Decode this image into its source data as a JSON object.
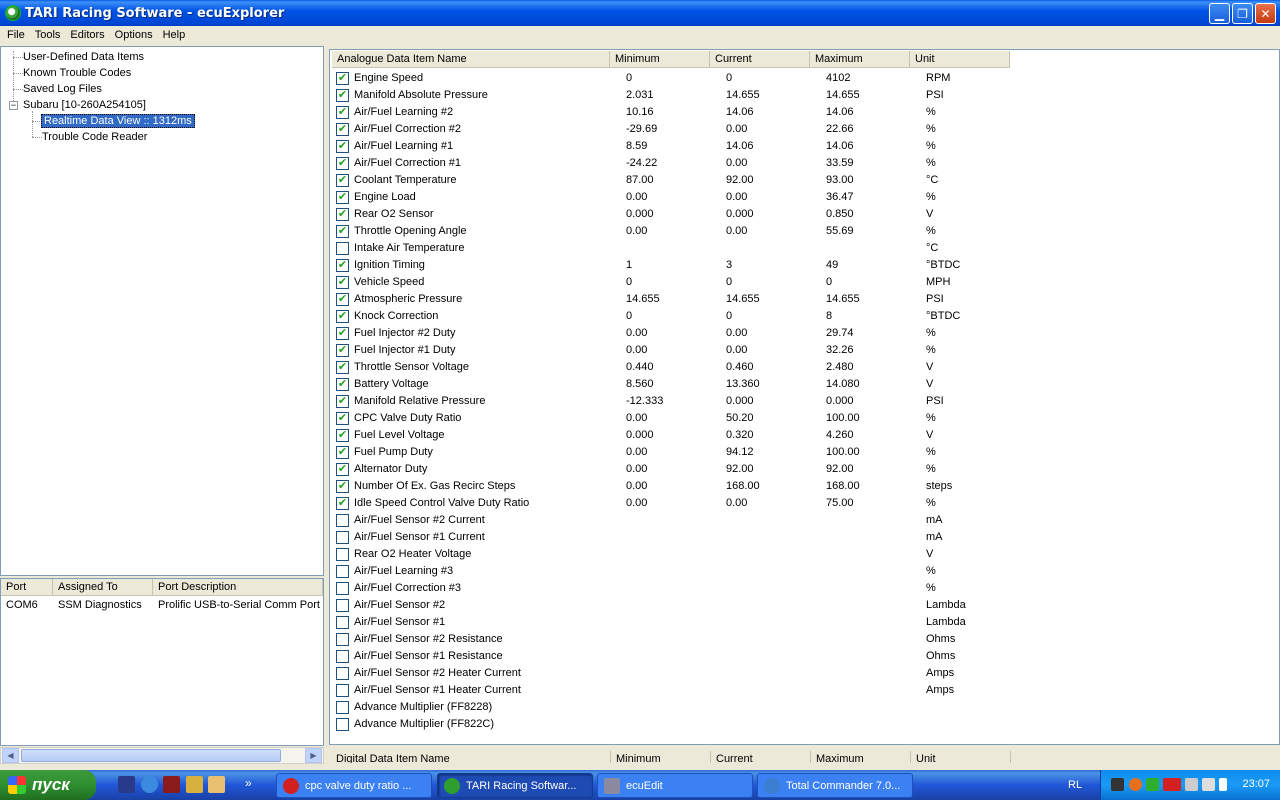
{
  "window": {
    "title": "TARI Racing Software - ecuExplorer"
  },
  "menu": [
    "File",
    "Tools",
    "Editors",
    "Options",
    "Help"
  ],
  "tree": {
    "user_defined": "User-Defined Data Items",
    "known_codes": "Known Trouble Codes",
    "saved_logs": "Saved Log Files",
    "subaru": "Subaru [10-260A254105]",
    "realtime": "Realtime Data View :: 1312ms",
    "trouble_reader": "Trouble Code Reader",
    "expander_symbol": "−"
  },
  "ports": {
    "headers": [
      "Port",
      "Assigned To",
      "Port Description"
    ],
    "rows": [
      [
        "COM6",
        "SSM Diagnostics",
        "Prolific USB-to-Serial Comm Port"
      ]
    ]
  },
  "analogue": {
    "headers": [
      "Analogue Data Item Name",
      "Minimum",
      "Current",
      "Maximum",
      "Unit"
    ],
    "rows": [
      {
        "checked": true,
        "name": "Engine Speed",
        "min": "0",
        "cur": "0",
        "max": "4102",
        "unit": "RPM"
      },
      {
        "checked": true,
        "name": "Manifold Absolute Pressure",
        "min": "2.031",
        "cur": "14.655",
        "max": "14.655",
        "unit": "PSI"
      },
      {
        "checked": true,
        "name": "Air/Fuel Learning #2",
        "min": "10.16",
        "cur": "14.06",
        "max": "14.06",
        "unit": "%"
      },
      {
        "checked": true,
        "name": "Air/Fuel Correction #2",
        "min": "-29.69",
        "cur": "0.00",
        "max": "22.66",
        "unit": "%"
      },
      {
        "checked": true,
        "name": "Air/Fuel Learning #1",
        "min": "8.59",
        "cur": "14.06",
        "max": "14.06",
        "unit": "%"
      },
      {
        "checked": true,
        "name": "Air/Fuel Correction #1",
        "min": "-24.22",
        "cur": "0.00",
        "max": "33.59",
        "unit": "%"
      },
      {
        "checked": true,
        "name": "Coolant Temperature",
        "min": "87.00",
        "cur": "92.00",
        "max": "93.00",
        "unit": "°C"
      },
      {
        "checked": true,
        "name": "Engine Load",
        "min": "0.00",
        "cur": "0.00",
        "max": "36.47",
        "unit": "%"
      },
      {
        "checked": true,
        "name": "Rear O2 Sensor",
        "min": "0.000",
        "cur": "0.000",
        "max": "0.850",
        "unit": "V"
      },
      {
        "checked": true,
        "name": "Throttle Opening Angle",
        "min": "0.00",
        "cur": "0.00",
        "max": "55.69",
        "unit": "%"
      },
      {
        "checked": false,
        "name": "Intake Air Temperature",
        "min": "",
        "cur": "",
        "max": "",
        "unit": "°C"
      },
      {
        "checked": true,
        "name": "Ignition Timing",
        "min": "1",
        "cur": "3",
        "max": "49",
        "unit": "°BTDC"
      },
      {
        "checked": true,
        "name": "Vehicle Speed",
        "min": "0",
        "cur": "0",
        "max": "0",
        "unit": "MPH"
      },
      {
        "checked": true,
        "name": "Atmospheric Pressure",
        "min": "14.655",
        "cur": "14.655",
        "max": "14.655",
        "unit": "PSI"
      },
      {
        "checked": true,
        "name": "Knock Correction",
        "min": "0",
        "cur": "0",
        "max": "8",
        "unit": "°BTDC"
      },
      {
        "checked": true,
        "name": "Fuel Injector #2 Duty",
        "min": "0.00",
        "cur": "0.00",
        "max": "29.74",
        "unit": "%"
      },
      {
        "checked": true,
        "name": "Fuel Injector #1 Duty",
        "min": "0.00",
        "cur": "0.00",
        "max": "32.26",
        "unit": "%"
      },
      {
        "checked": true,
        "name": "Throttle Sensor Voltage",
        "min": "0.440",
        "cur": "0.460",
        "max": "2.480",
        "unit": "V"
      },
      {
        "checked": true,
        "name": "Battery Voltage",
        "min": "8.560",
        "cur": "13.360",
        "max": "14.080",
        "unit": "V"
      },
      {
        "checked": true,
        "name": "Manifold Relative Pressure",
        "min": "-12.333",
        "cur": "0.000",
        "max": "0.000",
        "unit": "PSI"
      },
      {
        "checked": true,
        "name": "CPC Valve Duty Ratio",
        "min": "0.00",
        "cur": "50.20",
        "max": "100.00",
        "unit": "%"
      },
      {
        "checked": true,
        "name": "Fuel Level Voltage",
        "min": "0.000",
        "cur": "0.320",
        "max": "4.260",
        "unit": "V"
      },
      {
        "checked": true,
        "name": "Fuel Pump Duty",
        "min": "0.00",
        "cur": "94.12",
        "max": "100.00",
        "unit": "%"
      },
      {
        "checked": true,
        "name": "Alternator Duty",
        "min": "0.00",
        "cur": "92.00",
        "max": "92.00",
        "unit": "%"
      },
      {
        "checked": true,
        "name": "Number Of Ex. Gas Recirc Steps",
        "min": "0.00",
        "cur": "168.00",
        "max": "168.00",
        "unit": "steps"
      },
      {
        "checked": true,
        "name": "Idle Speed Control Valve Duty Ratio",
        "min": "0.00",
        "cur": "0.00",
        "max": "75.00",
        "unit": "%"
      },
      {
        "checked": false,
        "name": "Air/Fuel Sensor #2 Current",
        "min": "",
        "cur": "",
        "max": "",
        "unit": "mA"
      },
      {
        "checked": false,
        "name": "Air/Fuel Sensor #1 Current",
        "min": "",
        "cur": "",
        "max": "",
        "unit": "mA"
      },
      {
        "checked": false,
        "name": "Rear O2 Heater Voltage",
        "min": "",
        "cur": "",
        "max": "",
        "unit": "V"
      },
      {
        "checked": false,
        "name": "Air/Fuel Learning #3",
        "min": "",
        "cur": "",
        "max": "",
        "unit": "%"
      },
      {
        "checked": false,
        "name": "Air/Fuel Correction #3",
        "min": "",
        "cur": "",
        "max": "",
        "unit": "%"
      },
      {
        "checked": false,
        "name": "Air/Fuel Sensor #2",
        "min": "",
        "cur": "",
        "max": "",
        "unit": "Lambda"
      },
      {
        "checked": false,
        "name": "Air/Fuel Sensor #1",
        "min": "",
        "cur": "",
        "max": "",
        "unit": "Lambda"
      },
      {
        "checked": false,
        "name": "Air/Fuel Sensor #2 Resistance",
        "min": "",
        "cur": "",
        "max": "",
        "unit": "Ohms"
      },
      {
        "checked": false,
        "name": "Air/Fuel Sensor #1 Resistance",
        "min": "",
        "cur": "",
        "max": "",
        "unit": "Ohms"
      },
      {
        "checked": false,
        "name": "Air/Fuel Sensor #2 Heater Current",
        "min": "",
        "cur": "",
        "max": "",
        "unit": "Amps"
      },
      {
        "checked": false,
        "name": "Air/Fuel Sensor #1 Heater Current",
        "min": "",
        "cur": "",
        "max": "",
        "unit": "Amps"
      },
      {
        "checked": false,
        "name": "Advance Multiplier (FF8228)",
        "min": "",
        "cur": "",
        "max": "",
        "unit": ""
      },
      {
        "checked": false,
        "name": "Advance Multiplier (FF822C)",
        "min": "",
        "cur": "",
        "max": "",
        "unit": ""
      }
    ]
  },
  "digital": {
    "headers": [
      "Digital Data Item Name",
      "Minimum",
      "Current",
      "Maximum",
      "Unit"
    ]
  },
  "taskbar": {
    "start": "пуск",
    "tasks": [
      {
        "label": "cpc valve duty ratio ...",
        "icon_color": "#d21f1f"
      },
      {
        "label": "TARI Racing Softwar...",
        "icon_color": "#2e9e2e"
      },
      {
        "label": "ecuEdit",
        "icon_color": "#8a8aa0"
      },
      {
        "label": "Total Commander 7.0...",
        "icon_color": "#3c7fd0"
      }
    ],
    "language": "RL",
    "clock": "23:07"
  }
}
